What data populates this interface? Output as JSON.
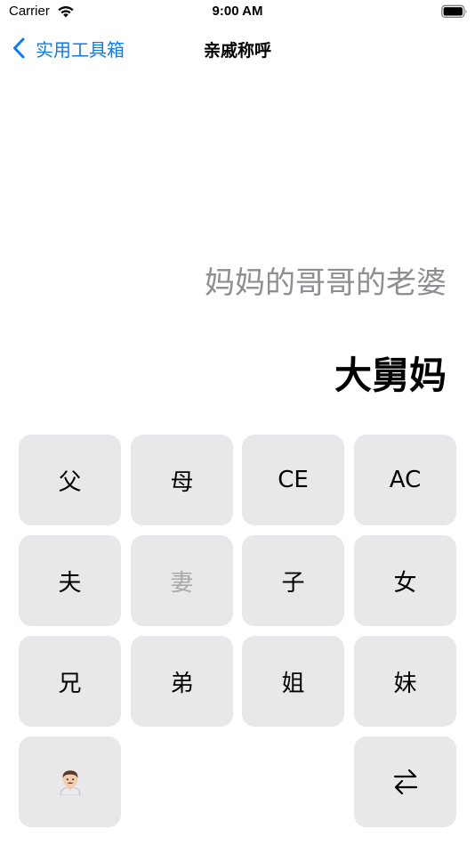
{
  "status_bar": {
    "carrier": "Carrier",
    "time": "9:00 AM"
  },
  "nav": {
    "back_label": "实用工具箱",
    "title": "亲戚称呼"
  },
  "display": {
    "expression": "妈妈的哥哥的老婆",
    "result": "大舅妈"
  },
  "keypad": {
    "rows": [
      [
        "父",
        "母",
        "CE",
        "AC"
      ],
      [
        "夫",
        "妻",
        "子",
        "女"
      ],
      [
        "兄",
        "弟",
        "姐",
        "妹"
      ]
    ],
    "disabled_key": "妻",
    "bottom_left": "man-avatar-icon",
    "bottom_right": "swap-arrows-icon"
  },
  "colors": {
    "accent": "#0a7aff",
    "key_bg": "#e8e8ea",
    "expression_gray": "#8e8e93"
  }
}
